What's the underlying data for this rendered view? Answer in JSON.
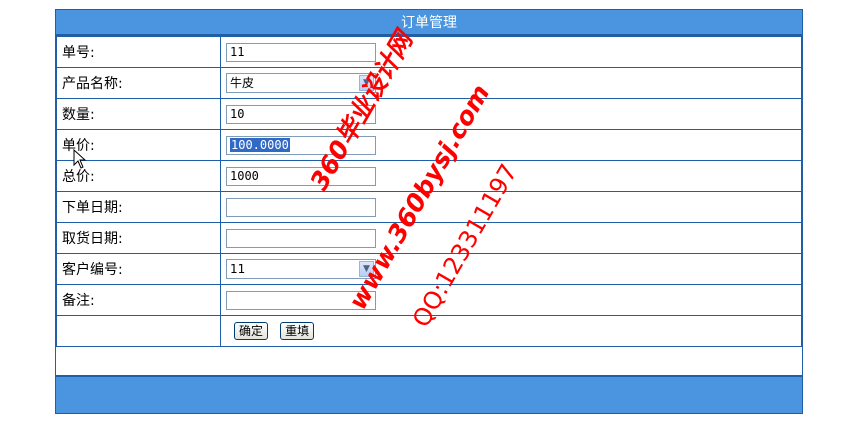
{
  "title": "订单管理",
  "fields": {
    "order_no": {
      "label": "单号:",
      "value": "11"
    },
    "product": {
      "label": "产品名称:",
      "value": "牛皮"
    },
    "quantity": {
      "label": "数量:",
      "value": "10"
    },
    "unit_price": {
      "label": "单价:",
      "value": "100.0000"
    },
    "total": {
      "label": "总价:",
      "value": "1000"
    },
    "order_date": {
      "label": "下单日期:",
      "value": ""
    },
    "pickup_date": {
      "label": "取货日期:",
      "value": ""
    },
    "customer_no": {
      "label": "客户编号:",
      "value": "11"
    },
    "remark": {
      "label": "备注:",
      "value": ""
    }
  },
  "buttons": {
    "confirm": "确定",
    "reset": "重填"
  },
  "watermark": {
    "line1": "360毕业设计网",
    "line2": "www.360bysj.com",
    "line3": "QQ:123311197"
  },
  "colors": {
    "header": "#4a94e0",
    "border": "#1e5fa8",
    "watermark": "#ff0000"
  }
}
